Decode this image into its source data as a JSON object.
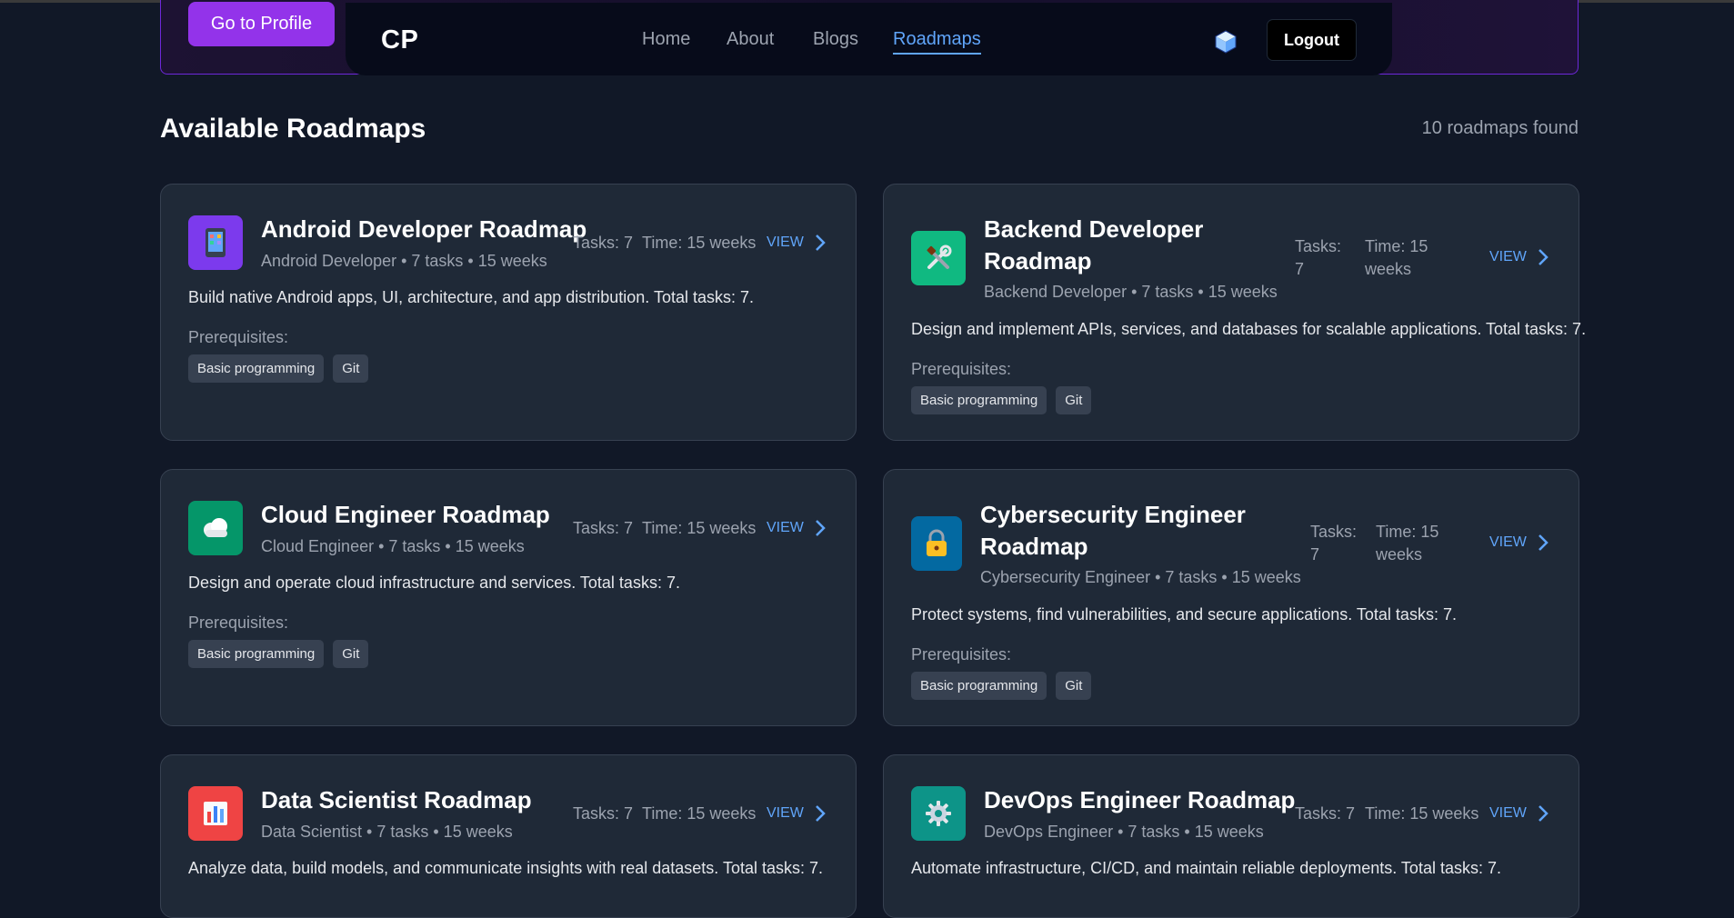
{
  "profile_button": "Go to Profile",
  "nav": {
    "logo": "CP",
    "links": [
      "Home",
      "About",
      "Blogs",
      "Roadmaps"
    ],
    "logout": "Logout"
  },
  "page": {
    "title": "Available Roadmaps",
    "count": "10 roadmaps found"
  },
  "common": {
    "prereq_label": "Prerequisites:",
    "view": "VIEW",
    "tags": [
      "Basic programming",
      "Git"
    ]
  },
  "cards": [
    {
      "title": "Android Developer Roadmap",
      "subtitle": "Android Developer • 7 tasks • 15 weeks",
      "tasks": "Tasks: 7",
      "time": "Time: 15 weeks",
      "desc": "Build native Android apps, UI, architecture, and app distribution. Total tasks: 7.",
      "icon": "phone-icon",
      "color": "#7c3aed"
    },
    {
      "title_l1": "Backend Developer",
      "title_l2": "Roadmap",
      "subtitle": "Backend Developer • 7 tasks • 15 weeks",
      "tasks_l1": "Tasks:",
      "tasks_l2": "7",
      "time_l1": "Time: 15",
      "time_l2": "weeks",
      "desc": "Design and implement APIs, services, and databases for scalable applications. Total tasks: 7.",
      "icon": "tools-icon",
      "color": "#10b981"
    },
    {
      "title": "Cloud Engineer Roadmap",
      "subtitle": "Cloud Engineer • 7 tasks • 15 weeks",
      "tasks": "Tasks: 7",
      "time": "Time: 15 weeks",
      "desc": "Design and operate cloud infrastructure and services. Total tasks: 7.",
      "icon": "cloud-icon",
      "color": "#059669"
    },
    {
      "title_l1": "Cybersecurity Engineer",
      "title_l2": "Roadmap",
      "subtitle": "Cybersecurity Engineer • 7 tasks • 15 weeks",
      "tasks_l1": "Tasks:",
      "tasks_l2": "7",
      "time_l1": "Time: 15",
      "time_l2": "weeks",
      "desc": "Protect systems, find vulnerabilities, and secure applications. Total tasks: 7.",
      "icon": "lock-icon",
      "color": "#0369a1"
    },
    {
      "title": "Data Scientist Roadmap",
      "subtitle": "Data Scientist • 7 tasks • 15 weeks",
      "tasks": "Tasks: 7",
      "time": "Time: 15 weeks",
      "desc": "Analyze data, build models, and communicate insights with real datasets. Total tasks: 7.",
      "icon": "chart-icon",
      "color": "#ef4444"
    },
    {
      "title": "DevOps Engineer Roadmap",
      "subtitle": "DevOps Engineer • 7 tasks • 15 weeks",
      "tasks": "Tasks: 7",
      "time": "Time: 15 weeks",
      "desc": "Automate infrastructure, CI/CD, and maintain reliable deployments. Total tasks: 7.",
      "icon": "gear-icon",
      "color": "#0d9488"
    }
  ]
}
